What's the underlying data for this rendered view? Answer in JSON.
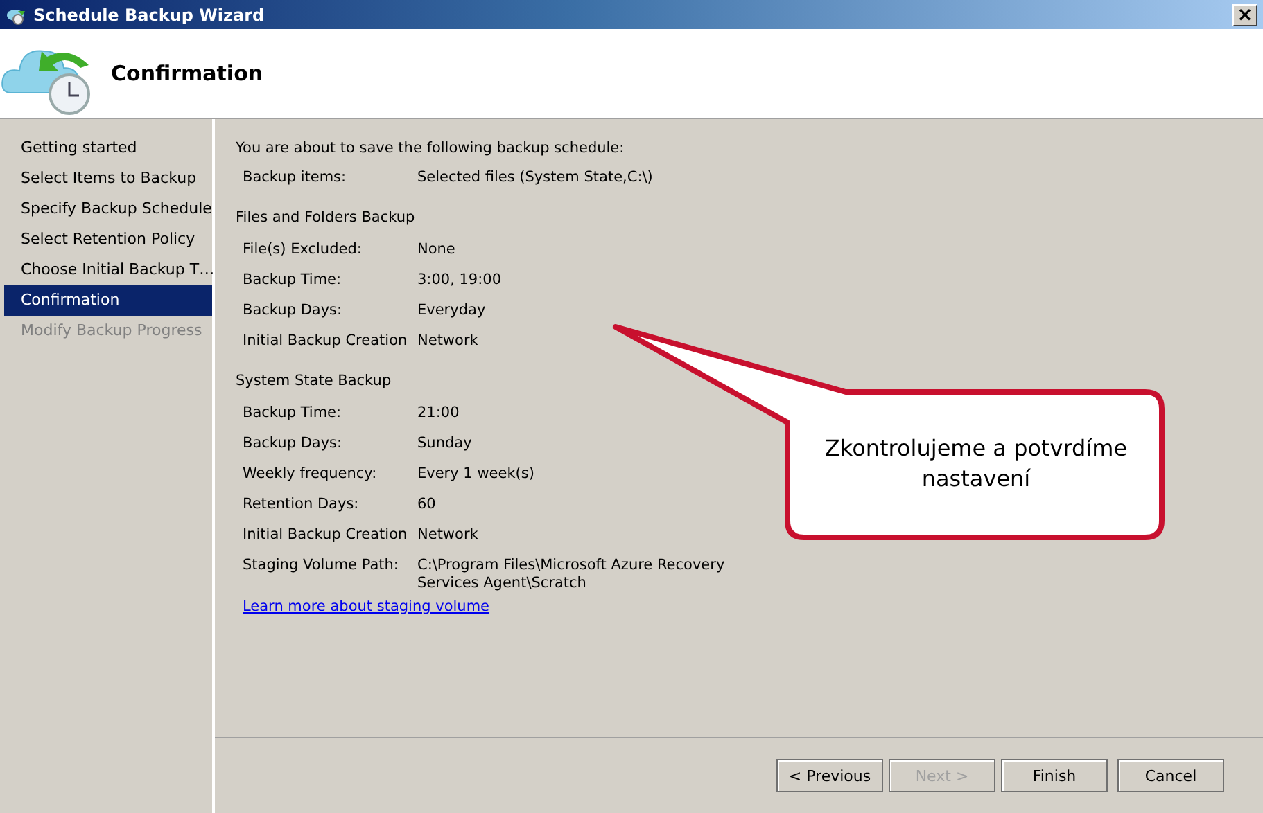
{
  "window": {
    "title": "Schedule Backup Wizard",
    "close": "×"
  },
  "header": {
    "title": "Confirmation"
  },
  "steps": [
    {
      "label": "Getting started",
      "selected": false,
      "disabled": false
    },
    {
      "label": "Select Items to Backup",
      "selected": false,
      "disabled": false
    },
    {
      "label": "Specify Backup Schedule",
      "selected": false,
      "disabled": false
    },
    {
      "label": "Select Retention Policy",
      "selected": false,
      "disabled": false
    },
    {
      "label": "Choose Initial Backup T…",
      "selected": false,
      "disabled": false
    },
    {
      "label": "Confirmation",
      "selected": true,
      "disabled": false
    },
    {
      "label": "Modify Backup Progress",
      "selected": false,
      "disabled": true
    }
  ],
  "summary": {
    "intro": "You are about to save the following backup schedule:",
    "entries": [
      {
        "kind": "row",
        "label": "Backup items:",
        "value": "Selected files (System State,C:\\)"
      },
      {
        "kind": "heading",
        "text": "Files and Folders Backup"
      },
      {
        "kind": "row",
        "label": "File(s) Excluded:",
        "value": "None"
      },
      {
        "kind": "row",
        "label": "Backup Time:",
        "value": "3:00, 19:00"
      },
      {
        "kind": "row",
        "label": "Backup Days:",
        "value": "Everyday"
      },
      {
        "kind": "row",
        "label": "Initial Backup Creation",
        "value": "Network"
      },
      {
        "kind": "heading",
        "text": "System State Backup"
      },
      {
        "kind": "row",
        "label": "Backup Time:",
        "value": "21:00"
      },
      {
        "kind": "row",
        "label": "Backup Days:",
        "value": "Sunday"
      },
      {
        "kind": "row",
        "label": "Weekly frequency:",
        "value": "Every 1 week(s)"
      },
      {
        "kind": "row",
        "label": "Retention Days:",
        "value": "60"
      },
      {
        "kind": "row",
        "label": "Initial Backup Creation",
        "value": "Network"
      },
      {
        "kind": "row",
        "label": "Staging Volume Path:",
        "value": "C:\\Program Files\\Microsoft Azure Recovery Services Agent\\Scratch"
      },
      {
        "kind": "link",
        "text": "Learn more about staging volume"
      }
    ]
  },
  "buttons": [
    {
      "label": "< Previous",
      "disabled": false
    },
    {
      "label": "Next >",
      "disabled": true
    },
    {
      "label": "Finish",
      "disabled": false
    },
    {
      "label": "Cancel",
      "disabled": false
    }
  ],
  "callout": {
    "text": "Zkontrolujeme a potvrdíme nastavení"
  }
}
